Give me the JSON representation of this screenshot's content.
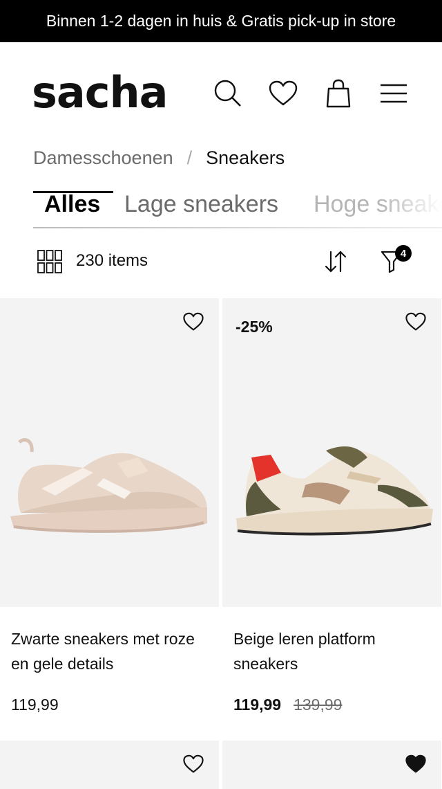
{
  "promo_bar": {
    "text": "Binnen 1-2 dagen in huis & Gratis pick-up in store"
  },
  "header": {
    "logo": "sacha",
    "icons": [
      "search-icon",
      "heart-icon",
      "bag-icon",
      "menu-icon"
    ]
  },
  "breadcrumb": {
    "parent": "Damesschoenen",
    "separator": "/",
    "current": "Sneakers"
  },
  "tabs": [
    {
      "label": "Alles",
      "active": true
    },
    {
      "label": "Lage sneakers",
      "active": false
    },
    {
      "label": "Hoge sneakers",
      "active": false
    }
  ],
  "toolbar": {
    "item_count": "230 items",
    "filter_count": "4"
  },
  "products": [
    {
      "title": "Zwarte sneakers met roze en gele details",
      "price": "119,99",
      "discount": "",
      "old_price": "",
      "favorited": false
    },
    {
      "title": "Beige leren platform sneakers",
      "price": "119,99",
      "discount": "-25%",
      "old_price": "139,99",
      "favorited": false
    }
  ],
  "next_row": [
    {
      "favorited": false
    },
    {
      "favorited": true
    }
  ],
  "colors": {
    "promo_bg": "#000000",
    "card_bg": "#f3f3f3",
    "text": "#111111",
    "muted": "#6b6b6b"
  }
}
